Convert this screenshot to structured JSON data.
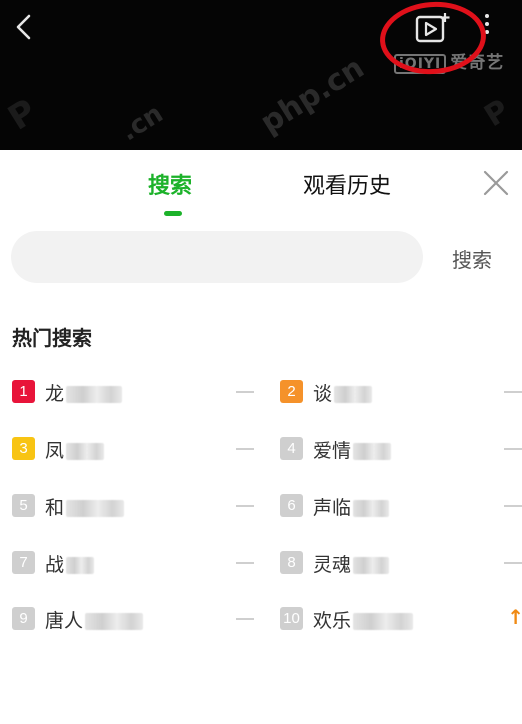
{
  "header": {
    "logo_badge": "iQIYI",
    "logo_text": "爱奇艺",
    "watermark_text": "php.cn"
  },
  "tabs": [
    {
      "label": "搜索",
      "active": true
    },
    {
      "label": "观看历史",
      "active": false
    }
  ],
  "search": {
    "placeholder": "",
    "value": "",
    "button_label": "搜索"
  },
  "hot_search": {
    "title": "热门搜索",
    "items": [
      {
        "rank": "1",
        "text": "龙",
        "trend": "flat",
        "rank_color": "#e8143a"
      },
      {
        "rank": "2",
        "text": "谈",
        "trend": "flat",
        "rank_color": "#f5922a"
      },
      {
        "rank": "3",
        "text": "凤",
        "trend": "flat",
        "rank_color": "#f8c413"
      },
      {
        "rank": "4",
        "text": "爱情",
        "trend": "flat",
        "rank_color": "#cfcfcf"
      },
      {
        "rank": "5",
        "text": "和",
        "trend": "flat",
        "rank_color": "#cfcfcf"
      },
      {
        "rank": "6",
        "text": "声临",
        "trend": "flat",
        "rank_color": "#cfcfcf"
      },
      {
        "rank": "7",
        "text": "战",
        "trend": "flat",
        "rank_color": "#cfcfcf"
      },
      {
        "rank": "8",
        "text": "灵魂",
        "trend": "flat",
        "rank_color": "#cfcfcf"
      },
      {
        "rank": "9",
        "text": "唐人",
        "trend": "flat",
        "rank_color": "#cfcfcf"
      },
      {
        "rank": "10",
        "text": "欢乐",
        "trend": "up",
        "rank_color": "#cfcfcf"
      }
    ],
    "up_arrow": "↑"
  },
  "icons": {
    "back": "chevron-left-icon",
    "cast": "video-add-icon",
    "more": "more-vertical-icon",
    "close": "close-icon"
  },
  "colors": {
    "accent": "#1cb22a",
    "annotation_circle": "#e0101a",
    "trend_up": "#f08a14"
  }
}
